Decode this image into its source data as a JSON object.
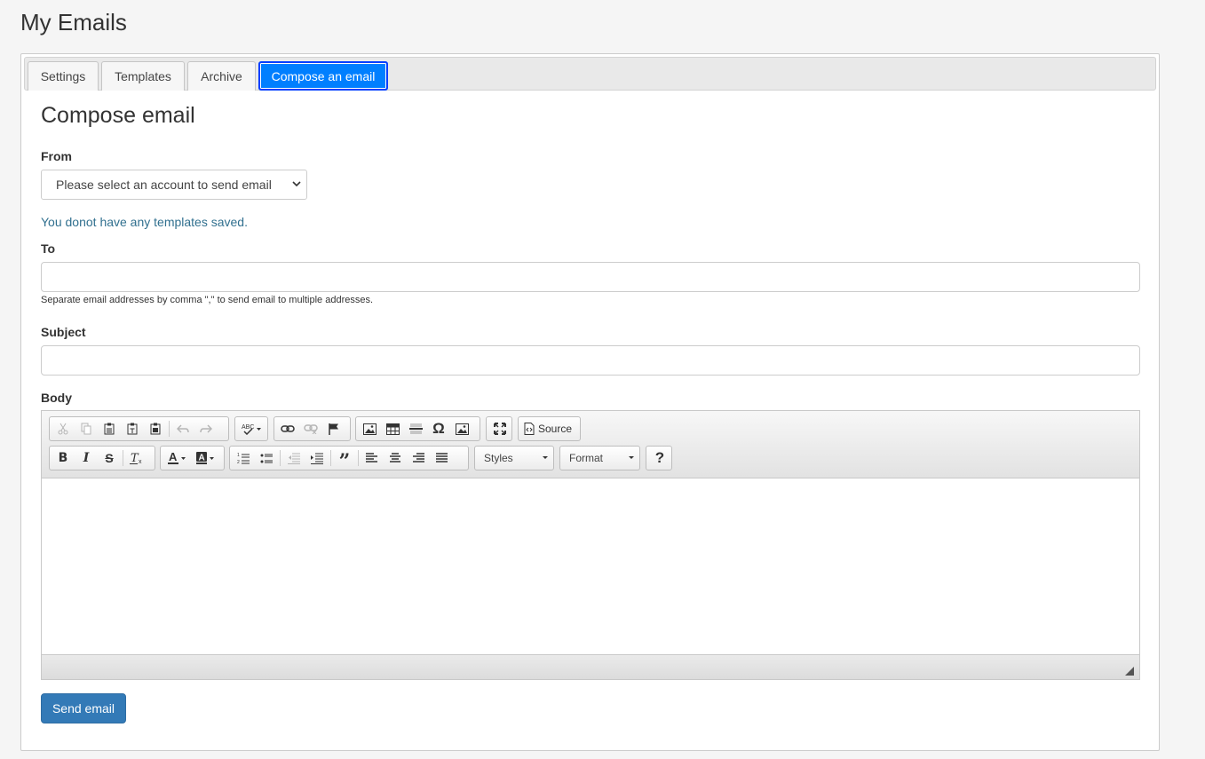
{
  "page": {
    "title": "My Emails"
  },
  "tabs": [
    {
      "label": "Settings"
    },
    {
      "label": "Templates"
    },
    {
      "label": "Archive"
    },
    {
      "label": "Compose an email",
      "active": true
    }
  ],
  "form": {
    "heading": "Compose email",
    "from_label": "From",
    "from_select_value": "Please select an account to send email",
    "templates_info": "You donot have any templates saved.",
    "to_label": "To",
    "to_value": "",
    "to_help": "Separate email addresses by comma \",\" to send email to multiple addresses.",
    "subject_label": "Subject",
    "subject_value": "",
    "body_label": "Body",
    "send_label": "Send email"
  },
  "editor": {
    "source_label": "Source",
    "styles_label": "Styles",
    "format_label": "Format",
    "help_glyph": "?",
    "icons_row1": [
      "cut-icon",
      "copy-icon",
      "paste-icon",
      "paste-text-icon",
      "paste-word-icon",
      "undo-icon",
      "redo-icon",
      "spellcheck-icon",
      "link-icon",
      "unlink-icon",
      "anchor-icon",
      "image-icon",
      "table-icon",
      "horizontal-rule-icon",
      "special-char-icon",
      "image2-icon",
      "maximize-icon",
      "source-icon"
    ],
    "icons_row2": [
      "bold-icon",
      "italic-icon",
      "strike-icon",
      "remove-format-icon",
      "text-color-icon",
      "bg-color-icon",
      "numbered-list-icon",
      "bulleted-list-icon",
      "outdent-icon",
      "indent-icon",
      "blockquote-icon",
      "align-left-icon",
      "align-center-icon",
      "align-right-icon",
      "justify-icon",
      "help-icon"
    ]
  },
  "colors": {
    "active_tab": "#007fff",
    "primary_button": "#337ab7",
    "info_text": "#31708f"
  }
}
